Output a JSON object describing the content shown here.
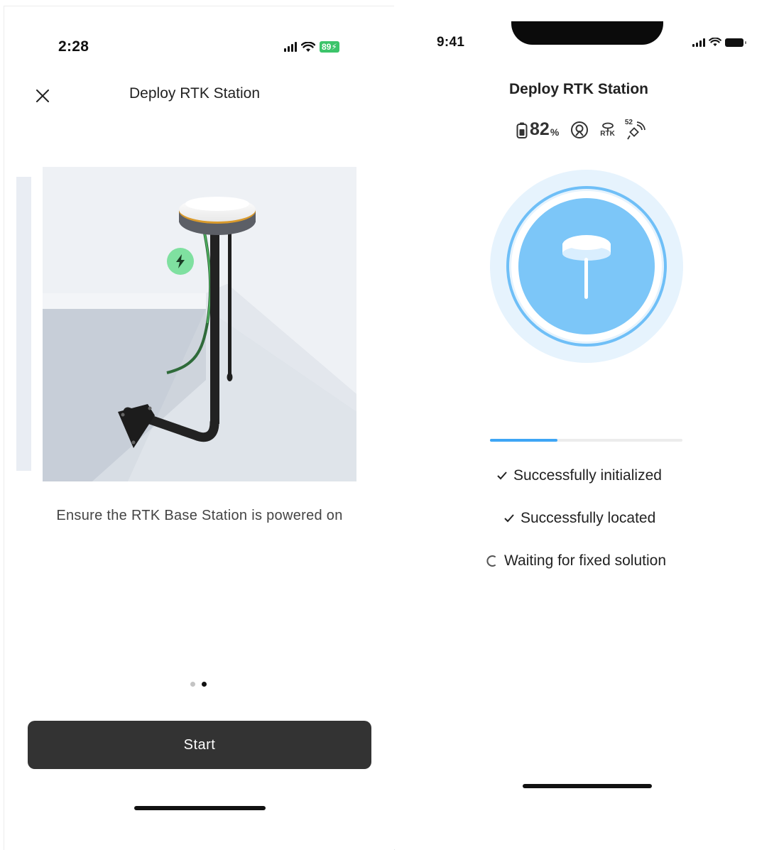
{
  "left_screen": {
    "status_bar": {
      "time": "2:28",
      "battery": "89"
    },
    "title": "Deploy RTK Station",
    "caption": "Ensure the RTK Base Station is powered on",
    "pagination": {
      "count": 2,
      "active": 2
    },
    "start_label": "Start",
    "icons": [
      "close-icon",
      "lightning-icon",
      "signal-icon",
      "wifi-icon",
      "battery-charging-icon"
    ],
    "accent_color": "#3cc46a"
  },
  "right_screen": {
    "status_bar": {
      "time": "9:41"
    },
    "title": "Deploy RTK Station",
    "device_status": {
      "battery_value": "82",
      "battery_unit": "%",
      "rtk_label": "RTK",
      "satellite_count": "52"
    },
    "progress_fraction": 0.35,
    "steps": [
      {
        "label": "Successfully initialized",
        "state": "done"
      },
      {
        "label": "Successfully located",
        "state": "done"
      },
      {
        "label": "Waiting for fixed solution",
        "state": "loading"
      }
    ],
    "accent_color": "#3ea6f5"
  }
}
